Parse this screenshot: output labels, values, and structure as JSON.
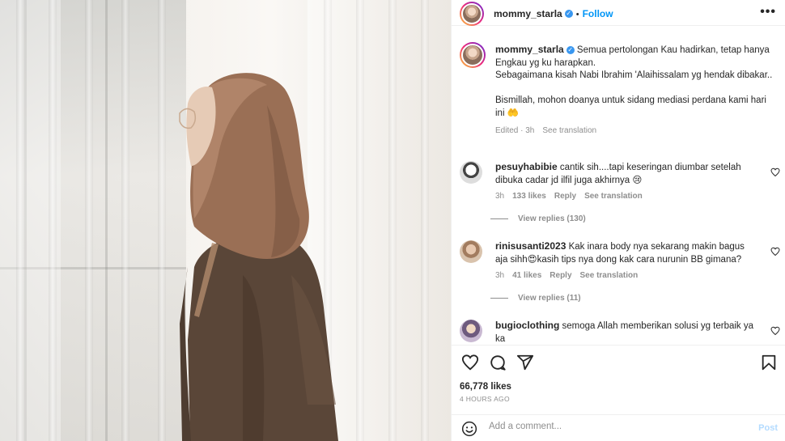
{
  "post": {
    "username": "mommy_starla",
    "follow_label": "Follow",
    "dot": "•",
    "more_label": "•••"
  },
  "caption": {
    "username": "mommy_starla",
    "lines": [
      "Semua pertolongan Kau hadirkan, tetap hanya Engkau yg ku harapkan.",
      "Sebagaimana kisah Nabi Ibrahim 'Alaihissalam yg hendak dibakar..",
      "",
      "Bismillah, mohon doanya untuk sidang mediasi perdana kami hari ini 🤲"
    ],
    "edited": "Edited · 3h",
    "see_translation": "See translation"
  },
  "comments": [
    {
      "username": "pesuyhabibie",
      "text": "cantik sih....tapi keseringan diumbar setelah dibuka cadar jd ilfil juga akhirnya 😢",
      "time": "3h",
      "likes": "133 likes",
      "reply": "Reply",
      "see_translation": "See translation",
      "view_replies": "View replies (130)"
    },
    {
      "username": "rinisusanti2023",
      "text": "Kak inara body nya sekarang makin bagus aja sihh😍kasih tips nya dong kak cara nurunin BB gimana?",
      "time": "3h",
      "likes": "41 likes",
      "reply": "Reply",
      "see_translation": "See translation",
      "view_replies": "View replies (11)"
    },
    {
      "username": "bugioclothing",
      "text": "semoga Allah memberikan solusi yg terbaik ya ka"
    }
  ],
  "stats": {
    "likes": "66,778 likes",
    "time_ago": "4 HOURS AGO"
  },
  "add_comment": {
    "placeholder": "Add a comment...",
    "post_label": "Post"
  },
  "colors": {
    "accent": "#0095f6",
    "verified": "#3897f0",
    "muted": "#8e8e8e"
  }
}
